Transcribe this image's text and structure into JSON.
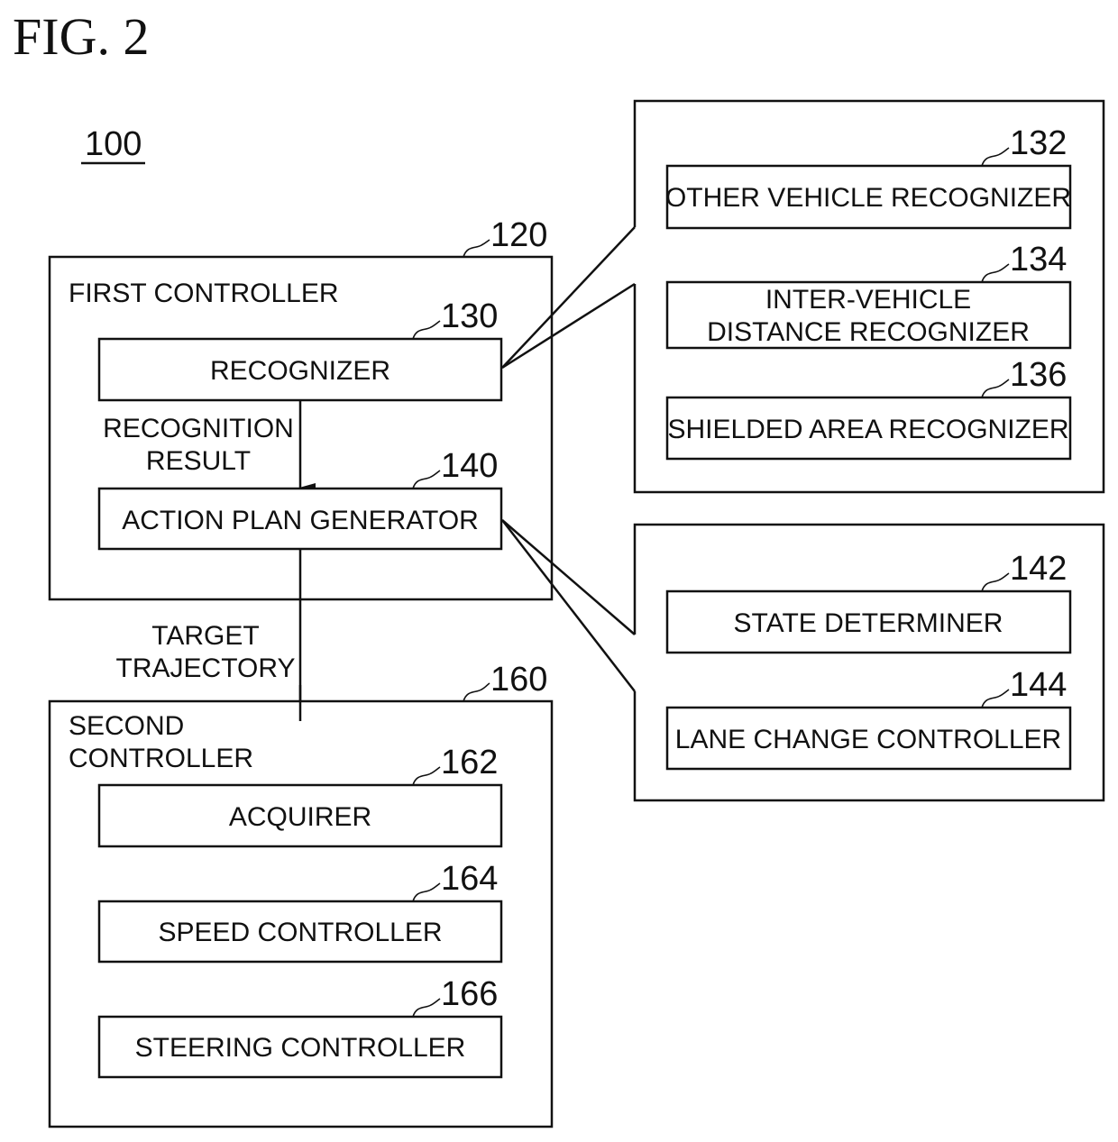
{
  "figure": {
    "title": "FIG. 2",
    "system_ref": "100"
  },
  "first_controller": {
    "ref": "120",
    "title": "FIRST CONTROLLER",
    "recognizer": {
      "ref": "130",
      "label": "RECOGNIZER"
    },
    "flow_label": [
      "RECOGNITION",
      "RESULT"
    ],
    "action_plan_generator": {
      "ref": "140",
      "label": "ACTION PLAN GENERATOR"
    }
  },
  "target_trajectory_label": [
    "TARGET",
    "TRAJECTORY"
  ],
  "second_controller": {
    "ref": "160",
    "title": [
      "SECOND",
      "CONTROLLER"
    ],
    "acquirer": {
      "ref": "162",
      "label": "ACQUIRER"
    },
    "speed_controller": {
      "ref": "164",
      "label": "SPEED CONTROLLER"
    },
    "steering_controller": {
      "ref": "166",
      "label": "STEERING CONTROLLER"
    }
  },
  "recognizer_detail": {
    "other_vehicle_recognizer": {
      "ref": "132",
      "label": "OTHER VEHICLE RECOGNIZER"
    },
    "inter_vehicle_distance_recognizer": {
      "ref": "134",
      "label": [
        "INTER-VEHICLE",
        "DISTANCE RECOGNIZER"
      ]
    },
    "shielded_area_recognizer": {
      "ref": "136",
      "label": "SHIELDED AREA RECOGNIZER"
    }
  },
  "action_plan_detail": {
    "state_determiner": {
      "ref": "142",
      "label": "STATE DETERMINER"
    },
    "lane_change_controller": {
      "ref": "144",
      "label": "LANE CHANGE CONTROLLER"
    }
  }
}
